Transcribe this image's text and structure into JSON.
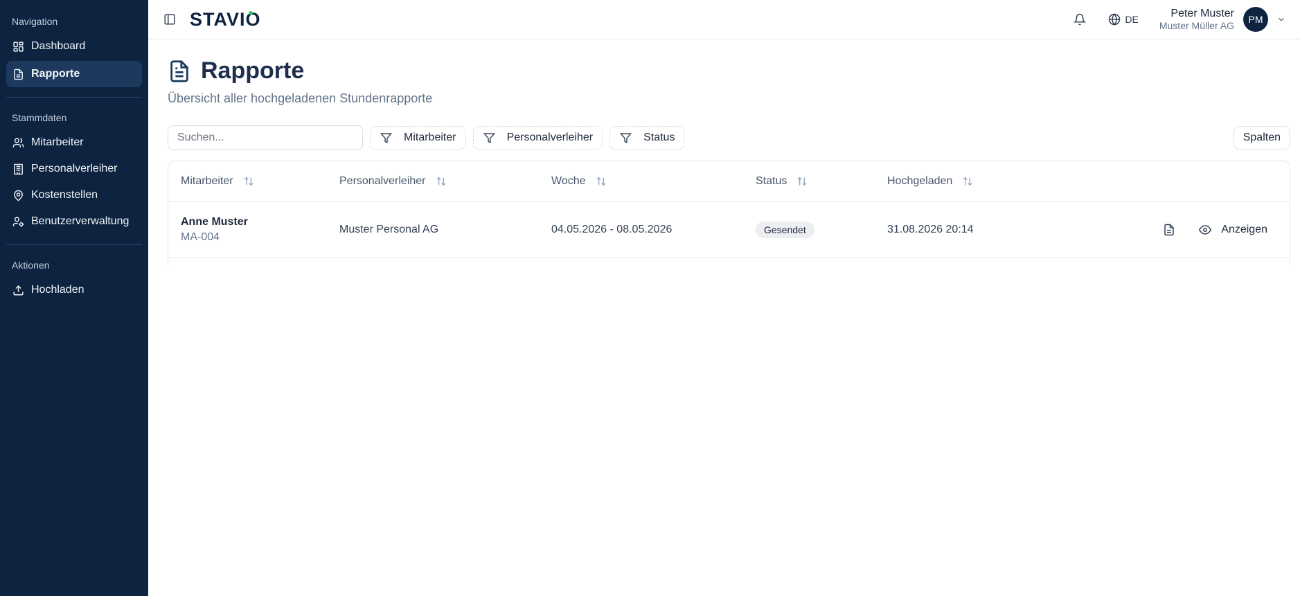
{
  "sidebar": {
    "groups": [
      {
        "title": "Navigation",
        "items": [
          {
            "label": "Dashboard",
            "icon": "dashboard-icon"
          },
          {
            "label": "Rapporte",
            "icon": "file-text-icon",
            "active": true
          }
        ]
      },
      {
        "title": "Stammdaten",
        "items": [
          {
            "label": "Mitarbeiter",
            "icon": "users-icon"
          },
          {
            "label": "Personalverleiher",
            "icon": "building-icon"
          },
          {
            "label": "Kostenstellen",
            "icon": "map-pin-icon"
          },
          {
            "label": "Benutzerverwaltung",
            "icon": "user-cog-icon"
          }
        ]
      },
      {
        "title": "Aktionen",
        "items": [
          {
            "label": "Hochladen",
            "icon": "upload-icon"
          }
        ]
      }
    ]
  },
  "header": {
    "brand": "STAVIO",
    "language": "DE",
    "user": {
      "name": "Peter Muster",
      "company": "Muster Müller AG",
      "initials": "PM"
    }
  },
  "page": {
    "title": "Rapporte",
    "subtitle": "Übersicht aller hochgeladenen Stundenrapporte"
  },
  "toolbar": {
    "search_placeholder": "Suchen...",
    "filters": [
      "Mitarbeiter",
      "Personalverleiher",
      "Status"
    ],
    "columns_label": "Spalten"
  },
  "table": {
    "headers": [
      "Mitarbeiter",
      "Personalverleiher",
      "Woche",
      "Status",
      "Hochgeladen"
    ],
    "rows": [
      {
        "name": "Anne Muster",
        "id": "MA-004",
        "lender": "Muster Personal AG",
        "week": "04.05.2026 - 08.05.2026",
        "status": "Gesendet",
        "uploaded": "31.08.2026 20:14",
        "action_label": "Anzeigen"
      }
    ]
  },
  "colors": {
    "sidebar_bg": "#0d2340",
    "sidebar_active": "#1d3a5e",
    "brand": "#0d2340",
    "brand_accent": "#22c55e"
  }
}
